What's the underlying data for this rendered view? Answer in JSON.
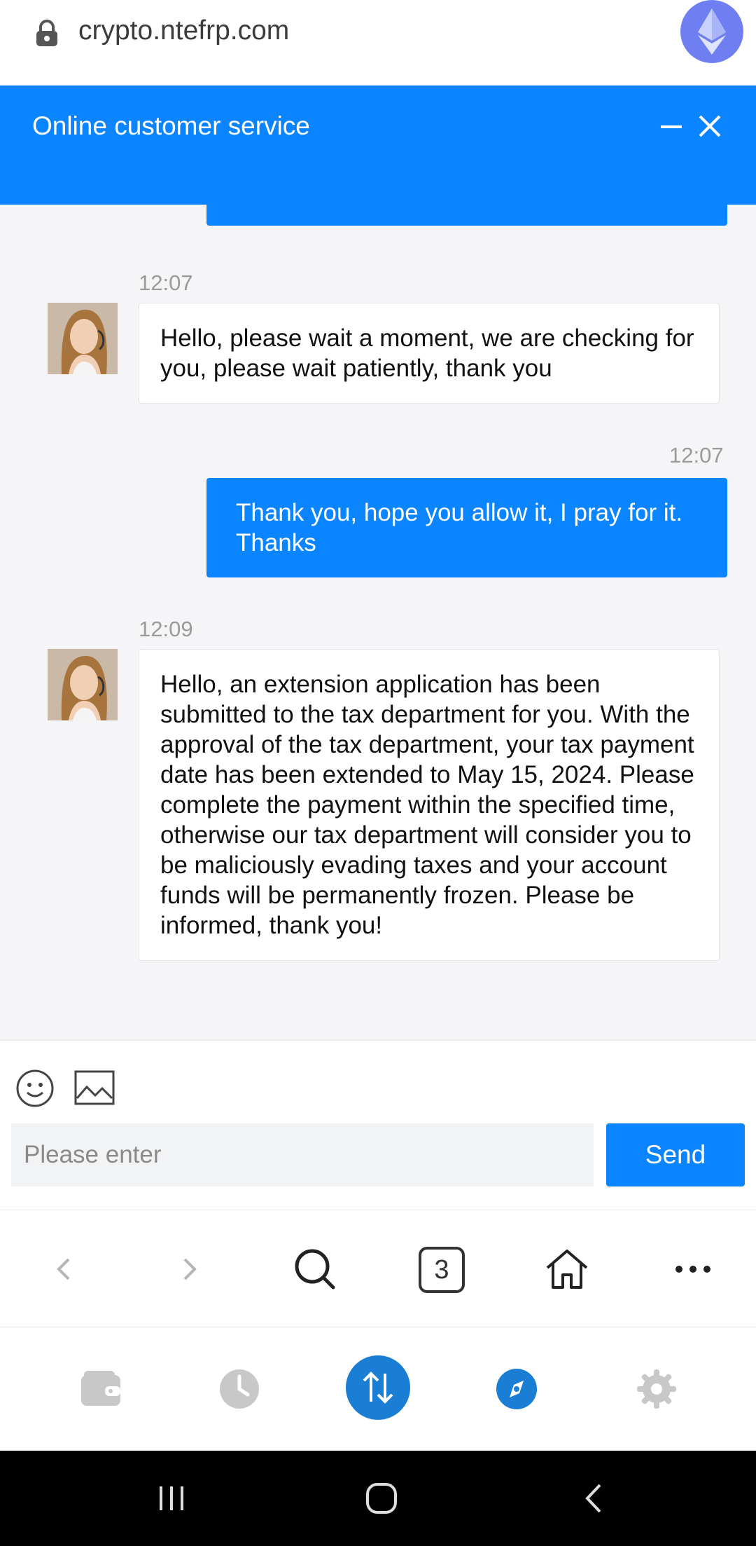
{
  "browser": {
    "url": "crypto.ntefrp.com",
    "tab_count": "3"
  },
  "chat_window": {
    "title": "Online customer service"
  },
  "messages": [
    {
      "side": "in",
      "time": "12:07",
      "text": "Hello, please wait a moment, we are checking for you, please wait patiently, thank you"
    },
    {
      "side": "out",
      "time": "12:07",
      "text": "Thank you, hope you allow it, I pray for it. Thanks"
    },
    {
      "side": "in",
      "time": "12:09",
      "text": "Hello, an extension application has been submitted to the tax department for you. With the approval of the tax department, your tax payment date has been extended to May 15, 2024. Please complete the payment within the specified time, otherwise our tax department will consider you to be maliciously evading taxes and your account funds will be permanently frozen. Please be informed, thank you!"
    }
  ],
  "composer": {
    "placeholder": "Please enter",
    "send_label": "Send"
  },
  "colors": {
    "accent": "#0a84ff",
    "app_nav_active": "#1a7fd4",
    "app_nav_inactive": "#c8c8c8"
  },
  "icons": {
    "url_bar": [
      "lock-icon",
      "ethereum-icon"
    ],
    "chat_header": [
      "minimize-icon",
      "close-icon"
    ],
    "composer": [
      "emoji-icon",
      "image-icon"
    ],
    "browser_nav": [
      "back-icon",
      "forward-icon",
      "search-icon",
      "tabs-icon",
      "home-icon",
      "more-icon"
    ],
    "app_nav": [
      "wallet-icon",
      "history-icon",
      "swap-icon",
      "discover-icon",
      "settings-icon"
    ],
    "system_nav": [
      "recents-icon",
      "home-circle-icon",
      "back-nav-icon"
    ]
  }
}
